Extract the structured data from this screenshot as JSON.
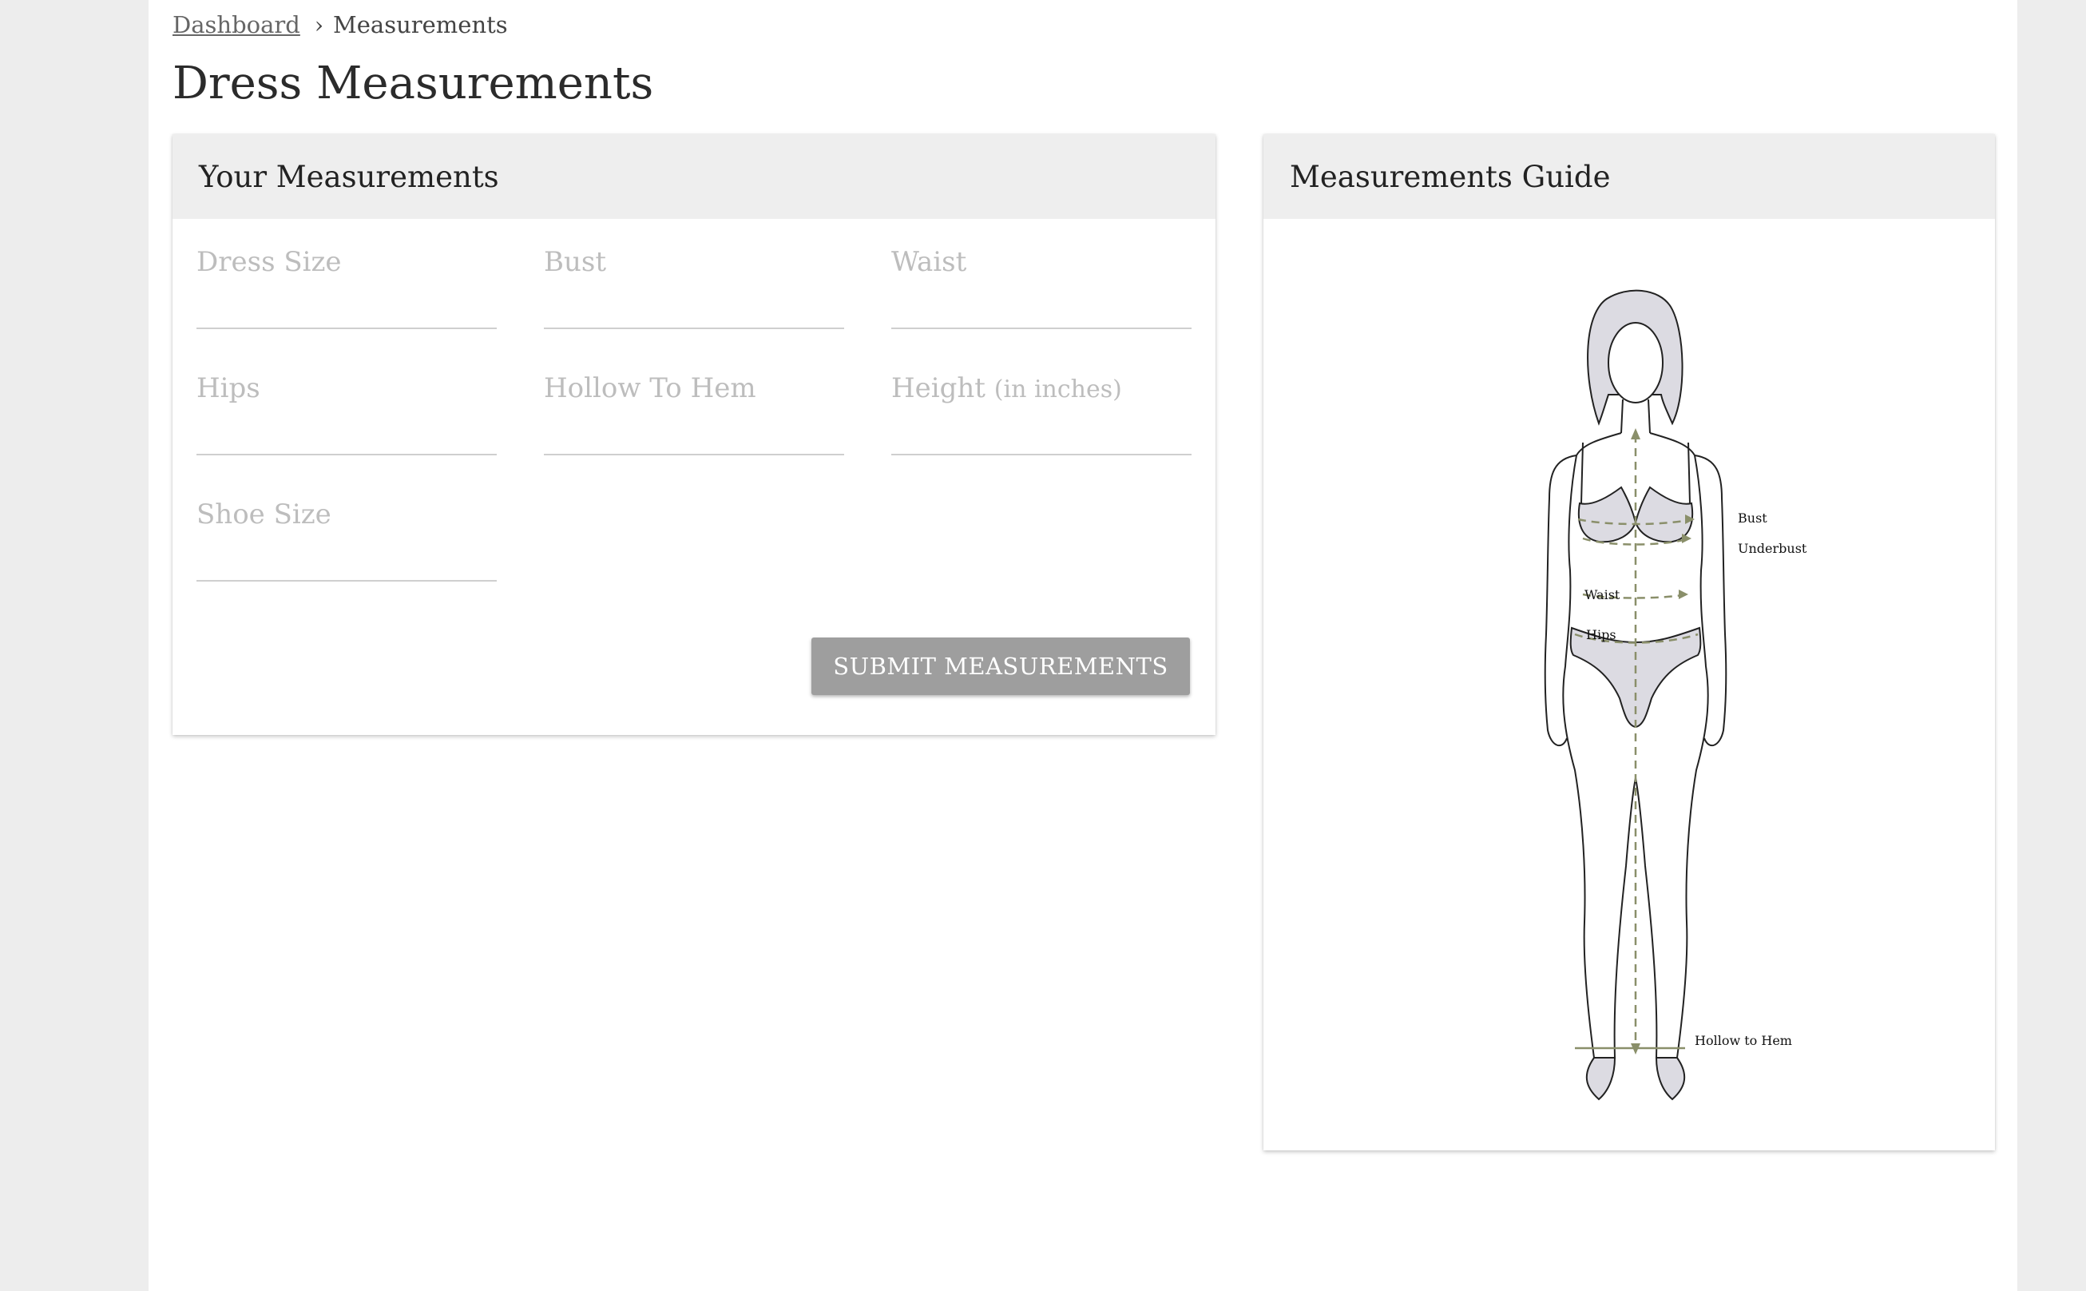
{
  "breadcrumb": {
    "home": "Dashboard",
    "separator": "›",
    "current": "Measurements"
  },
  "page_title": "Dress Measurements",
  "measurements_card": {
    "title": "Your Measurements",
    "fields": [
      {
        "label": "Dress Size",
        "unit": "",
        "value": ""
      },
      {
        "label": "Bust",
        "unit": "",
        "value": ""
      },
      {
        "label": "Waist",
        "unit": "",
        "value": ""
      },
      {
        "label": "Hips",
        "unit": "",
        "value": ""
      },
      {
        "label": "Hollow To Hem",
        "unit": "",
        "value": ""
      },
      {
        "label": "Height ",
        "unit": "(in inches)",
        "value": ""
      },
      {
        "label": "Shoe Size",
        "unit": "",
        "value": ""
      }
    ],
    "submit_label": "SUBMIT MEASUREMENTS"
  },
  "guide_card": {
    "title": "Measurements Guide",
    "labels": {
      "bust": "Bust",
      "underbust": "Underbust",
      "waist": "Waist",
      "hips": "Hips",
      "hollow_to_hem": "Hollow to Hem"
    }
  },
  "colors": {
    "background": "#ededed",
    "header_bg": "#eeeeee",
    "button_bg": "#9e9e9e",
    "guide_line": "#8a8f6a",
    "figure_fill": "#dcdbe2"
  }
}
